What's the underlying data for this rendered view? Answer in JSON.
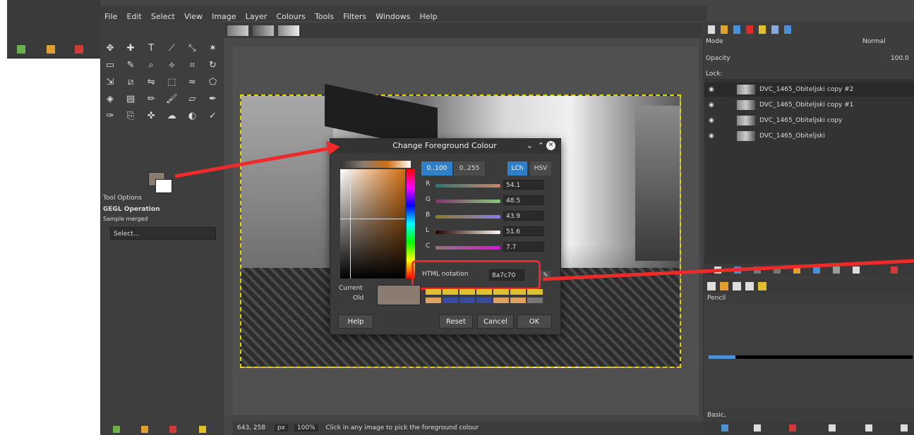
{
  "menubar": {
    "items": [
      "File",
      "Edit",
      "Select",
      "View",
      "Image",
      "Layer",
      "Colours",
      "Tools",
      "Filters",
      "Windows",
      "Help"
    ]
  },
  "toolbox": {
    "tool_options_title": "Tool Options",
    "gegl_title": "GEGL Operation",
    "sample_merged": "Sample merged",
    "operation_value": "Select..."
  },
  "dialog": {
    "title": "Change Foreground Colour",
    "scale_left": "0..100",
    "scale_right": "0..255",
    "mode_lch": "LCh",
    "mode_hsv": "HSV",
    "channels": [
      {
        "label": "R",
        "value": "54.1"
      },
      {
        "label": "G",
        "value": "48.5"
      },
      {
        "label": "B",
        "value": "43.9"
      },
      {
        "label": "L",
        "value": "51.6"
      },
      {
        "label": "C",
        "value": "7.7"
      }
    ],
    "hex_label": "HTML notation",
    "hex_value": "8a7c70",
    "current_label": "Current",
    "old_label": "Old",
    "help_button": "Help",
    "reset_button": "Reset",
    "cancel_button": "Cancel",
    "ok_button": "OK",
    "accent": "#2f7fc9",
    "hex_highlight_color": "#f0262a"
  },
  "layers": {
    "mode": "Normal",
    "opacity_label": "Opacity",
    "opacity_value": "100.0",
    "lock_label": "Lock:",
    "items": [
      "DVC_1465_Obiteljski copy #2",
      "DVC_1465_Obiteljski copy #1",
      "DVC_1465_Obiteljski copy",
      "DVC_1465_Obiteljski"
    ]
  },
  "brushes": {
    "label": "Pencil",
    "footer": "Basic,"
  },
  "statusbar": {
    "coords": "643, 258",
    "unit": "px",
    "zoom": "100%",
    "message": "Click in any image to pick the foreground colour"
  },
  "colors": {
    "foreground": "#8a7c70",
    "background": "#ffffff",
    "annotation_arrow": "#ee2a2a"
  }
}
